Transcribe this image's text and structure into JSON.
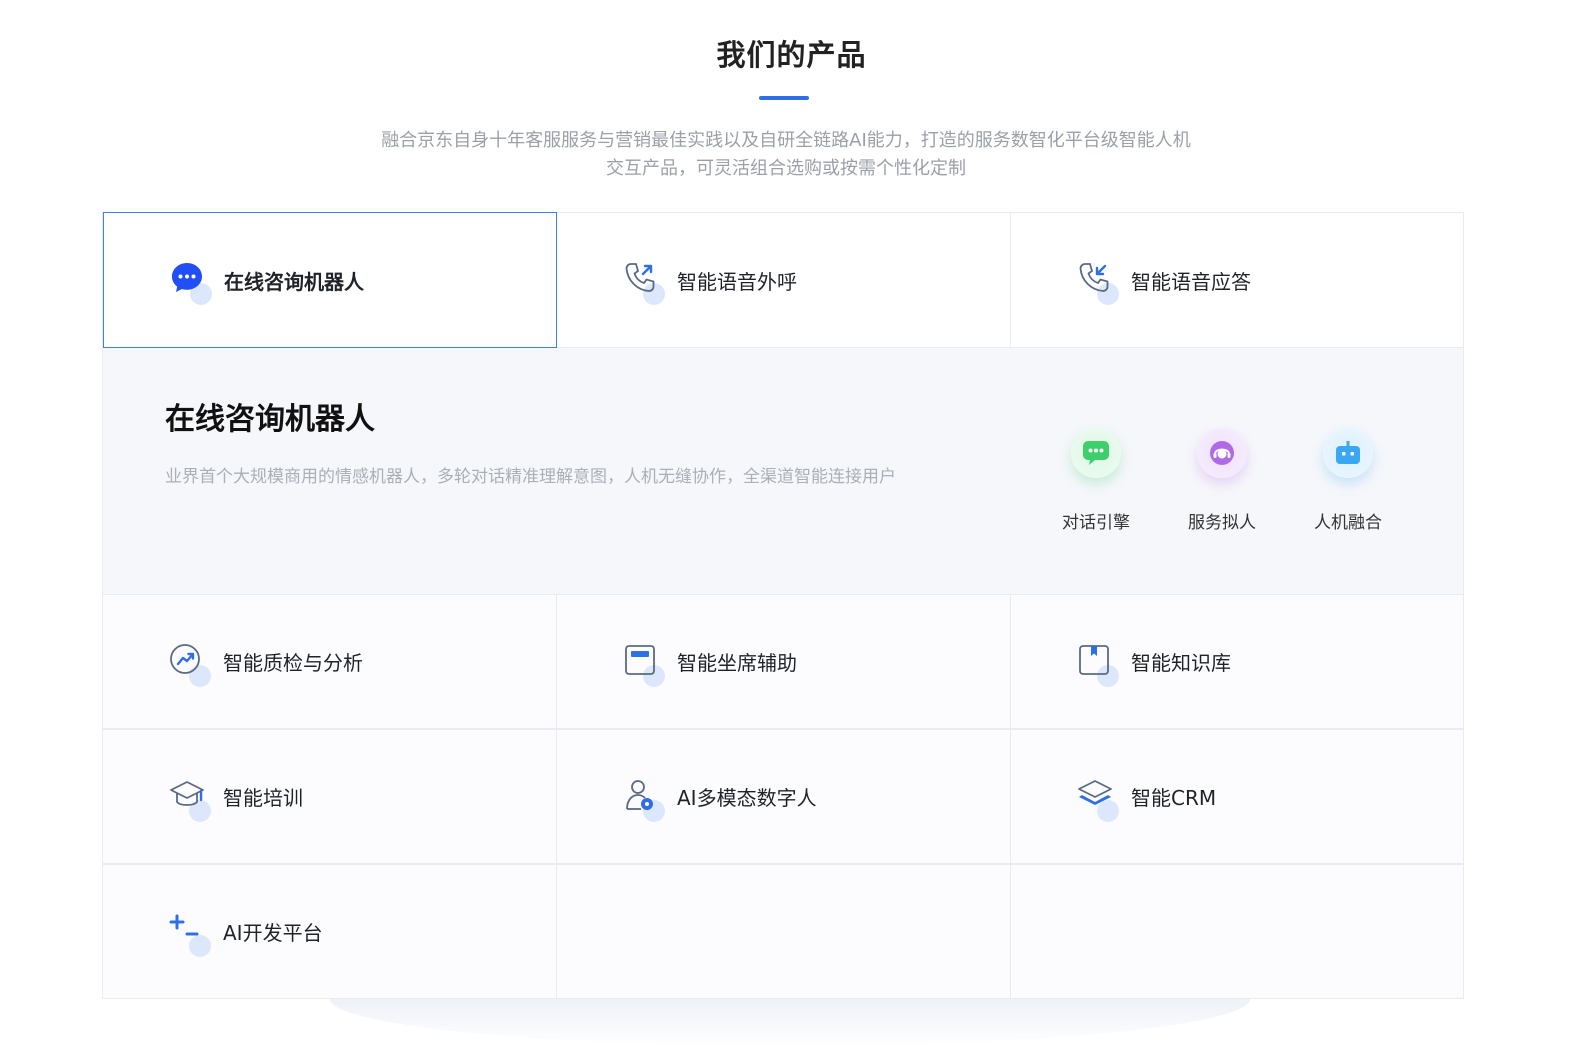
{
  "section": {
    "title": "我们的产品",
    "desc_line1": "融合京东自身十年客服服务与营销最佳实践以及自研全链路AI能力，打造的服务数智化平台级智能人机",
    "desc_line2": "交互产品，可灵活组合选购或按需个性化定制"
  },
  "tabs": [
    {
      "label": "在线咨询机器人",
      "icon": "chat-bubble-icon",
      "active": true
    },
    {
      "label": "智能语音外呼",
      "icon": "phone-outgoing-icon"
    },
    {
      "label": "智能语音应答",
      "icon": "phone-incoming-icon"
    }
  ],
  "detail": {
    "title": "在线咨询机器人",
    "desc": "业界首个大规模商用的情感机器人，多轮对话精准理解意图，人机无缝协作，全渠道智能连接用户",
    "features": [
      {
        "label": "对话引擎",
        "icon": "chat-engine-icon",
        "color": "#3ccf6a"
      },
      {
        "label": "服务拟人",
        "icon": "headset-icon",
        "color": "#b06ae8"
      },
      {
        "label": "人机融合",
        "icon": "robot-icon",
        "color": "#3aa7f2"
      }
    ]
  },
  "products": [
    {
      "label": "智能质检与分析",
      "icon": "trend-chart-icon"
    },
    {
      "label": "智能坐席辅助",
      "icon": "window-icon"
    },
    {
      "label": "智能知识库",
      "icon": "bookmark-book-icon"
    },
    {
      "label": "智能培训",
      "icon": "graduation-cap-icon"
    },
    {
      "label": "AI多模态数字人",
      "icon": "digital-human-icon"
    },
    {
      "label": "智能CRM",
      "icon": "layers-icon"
    },
    {
      "label": "AI开发平台",
      "icon": "plus-minus-icon"
    }
  ],
  "colors": {
    "accent": "#2f6fe6",
    "border": "#e8ebf0",
    "panel": "#f6f7fb"
  }
}
